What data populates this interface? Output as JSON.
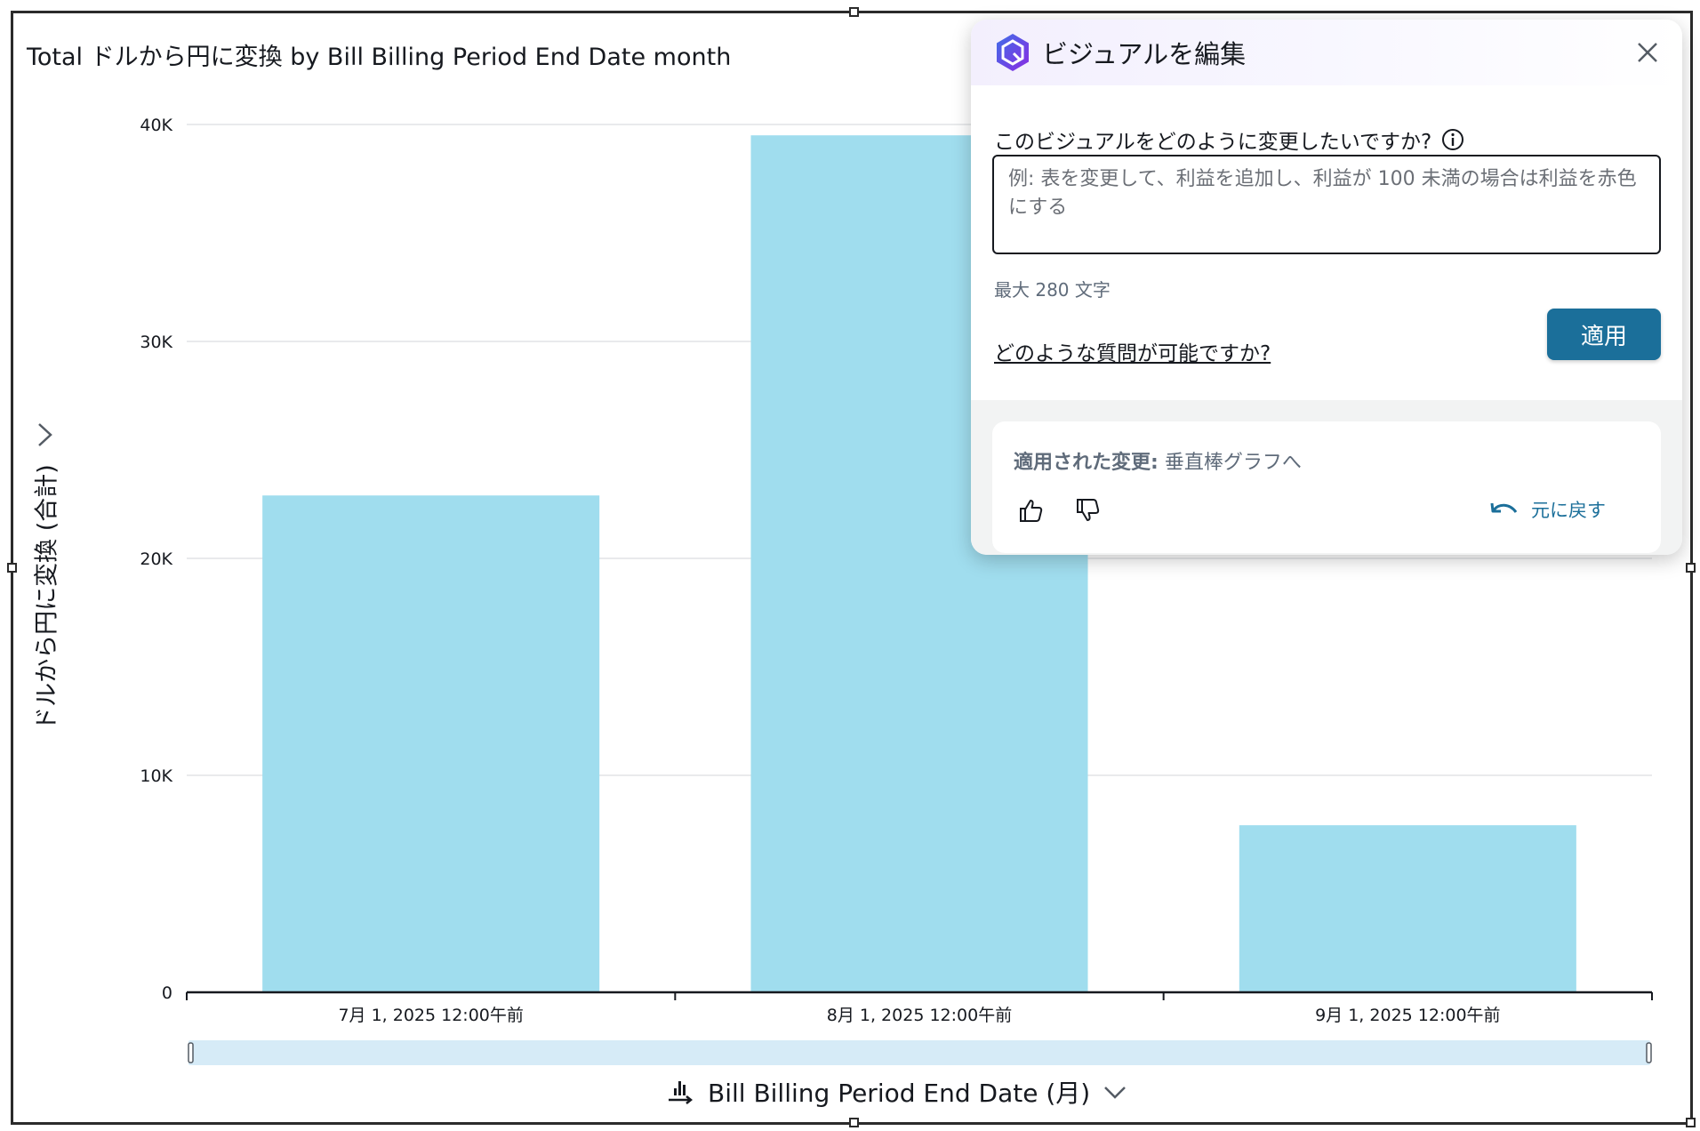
{
  "chart_data": {
    "type": "bar",
    "title": "Total ドルから円に変換 by Bill Billing Period End Date month",
    "categories": [
      "7月 1, 2025 12:00午前",
      "8月 1, 2025 12:00午前",
      "9月 1, 2025 12:00午前"
    ],
    "values": [
      22900,
      39500,
      7700
    ],
    "ylabel": "ドルから円に変換 (合計)",
    "xlabel": "Bill Billing Period End Date (月)",
    "ylim": [
      0,
      40000
    ],
    "yticks": [
      0,
      10000,
      20000,
      30000,
      40000
    ],
    "ytick_labels": [
      "0",
      "10K",
      "20K",
      "30K",
      "40K"
    ],
    "grid": true,
    "legend": "none",
    "bar_color": "#a0ddee"
  },
  "colors": {
    "accent": "#1b6f9a",
    "bar": "#a0ddee",
    "scrollbar": "#d6ebf7"
  },
  "panel": {
    "title": "ビジュアルを編集",
    "question": "このビジュアルをどのように変更したいですか?",
    "placeholder": "例: 表を変更して、利益を追加し、利益が 100 未満の場合は利益を赤色にする",
    "char_limit": "最大 280 文字",
    "help_link": "どのような質問が可能ですか?",
    "apply_label": "適用",
    "applied_label": "適用された変更:",
    "applied_value": "垂直棒グラフへ",
    "undo_label": "元に戻す"
  }
}
